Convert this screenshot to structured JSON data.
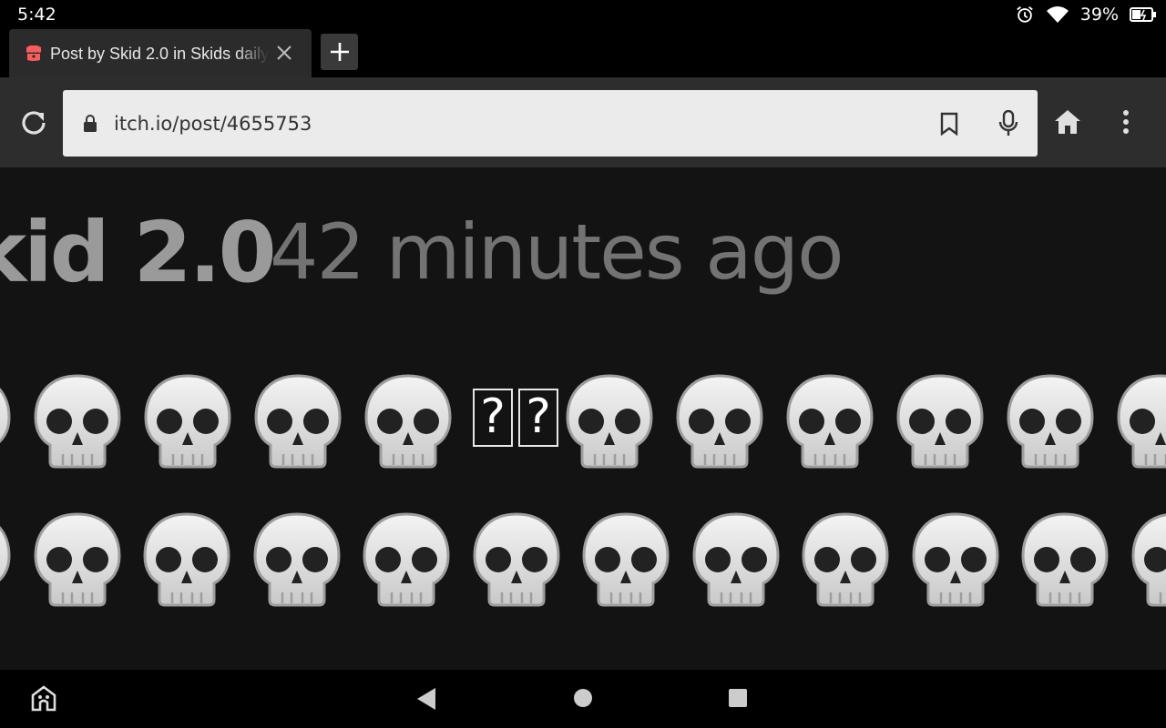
{
  "status_bar": {
    "time": "5:42",
    "battery_percent": "39%",
    "icons": [
      "alarm-icon",
      "wifi-icon",
      "battery-charging-icon"
    ]
  },
  "tab": {
    "title": "Post by Skid 2.0 in Skids daily",
    "favicon": "itch-io-icon",
    "close_icon": "close-icon"
  },
  "toolbar": {
    "url": "itch.io/post/4655753",
    "icons": [
      "reload-icon",
      "lock-icon",
      "bookmark-icon",
      "microphone-icon",
      "home-icon",
      "more-vertical-icon"
    ]
  },
  "post": {
    "author_fragment": "kid 2.0",
    "time_ago": "42 minutes ago",
    "emoji_row_1": [
      "skull",
      "skull",
      "skull",
      "skull",
      "skull",
      "missing",
      "missing",
      "skull",
      "skull",
      "skull",
      "skull",
      "skull",
      "skull"
    ],
    "emoji_row_2": [
      "skull",
      "skull",
      "skull",
      "skull",
      "skull",
      "skull",
      "skull",
      "skull",
      "skull",
      "skull",
      "skull",
      "skull"
    ],
    "missing_glyph": "?"
  },
  "nav_bar": {
    "icons": [
      "assistant-icon",
      "back-icon",
      "home-circle-icon",
      "recents-icon"
    ]
  },
  "colors": {
    "page_bg": "#131313",
    "toolbar_bg": "#2d2d2d",
    "url_bg": "#ebebeb",
    "favicon": "#fa5c5c"
  }
}
